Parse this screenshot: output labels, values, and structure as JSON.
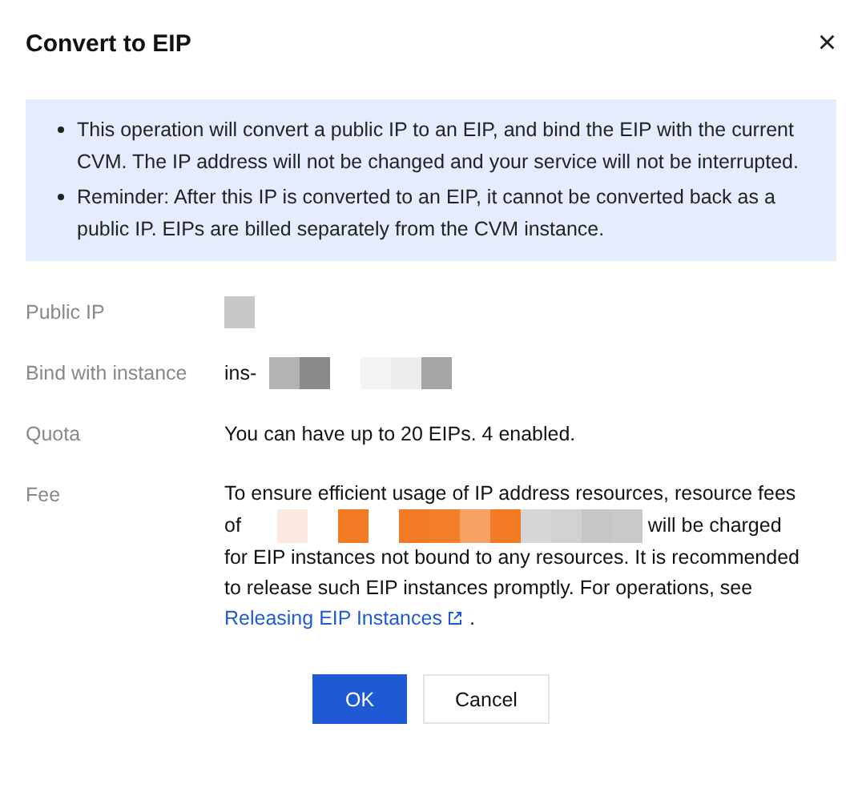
{
  "dialog": {
    "title": "Convert to EIP",
    "close": "×"
  },
  "notice": [
    "This operation will convert a public IP to an EIP, and bind the EIP with the current CVM. The IP address will not be changed and your service will not be interrupted.",
    "Reminder: After this IP is converted to an EIP, it cannot be converted back as a public IP. EIPs are billed separately from the CVM instance."
  ],
  "fields": [
    {
      "label": "Public IP",
      "kind": "masked"
    },
    {
      "label": "Bind with instance",
      "kind": "prefixed",
      "prefix": "ins-"
    },
    {
      "label": "Quota",
      "kind": "text",
      "value": "You can have up to 20 EIPs. 4 enabled."
    },
    {
      "label": "Fee",
      "kind": "fee",
      "before": "To ensure efficient usage of IP address resources, resource fees of",
      "after": "will be charged for EIP instances not bound to any resources. It is recommended to release such EIP instances promptly. For operations, see",
      "link": "Releasing EIP Instances",
      "end": "."
    }
  ],
  "buttons": [
    {
      "label": "OK",
      "kind": "primary"
    },
    {
      "label": "Cancel",
      "kind": "secondary"
    }
  ]
}
